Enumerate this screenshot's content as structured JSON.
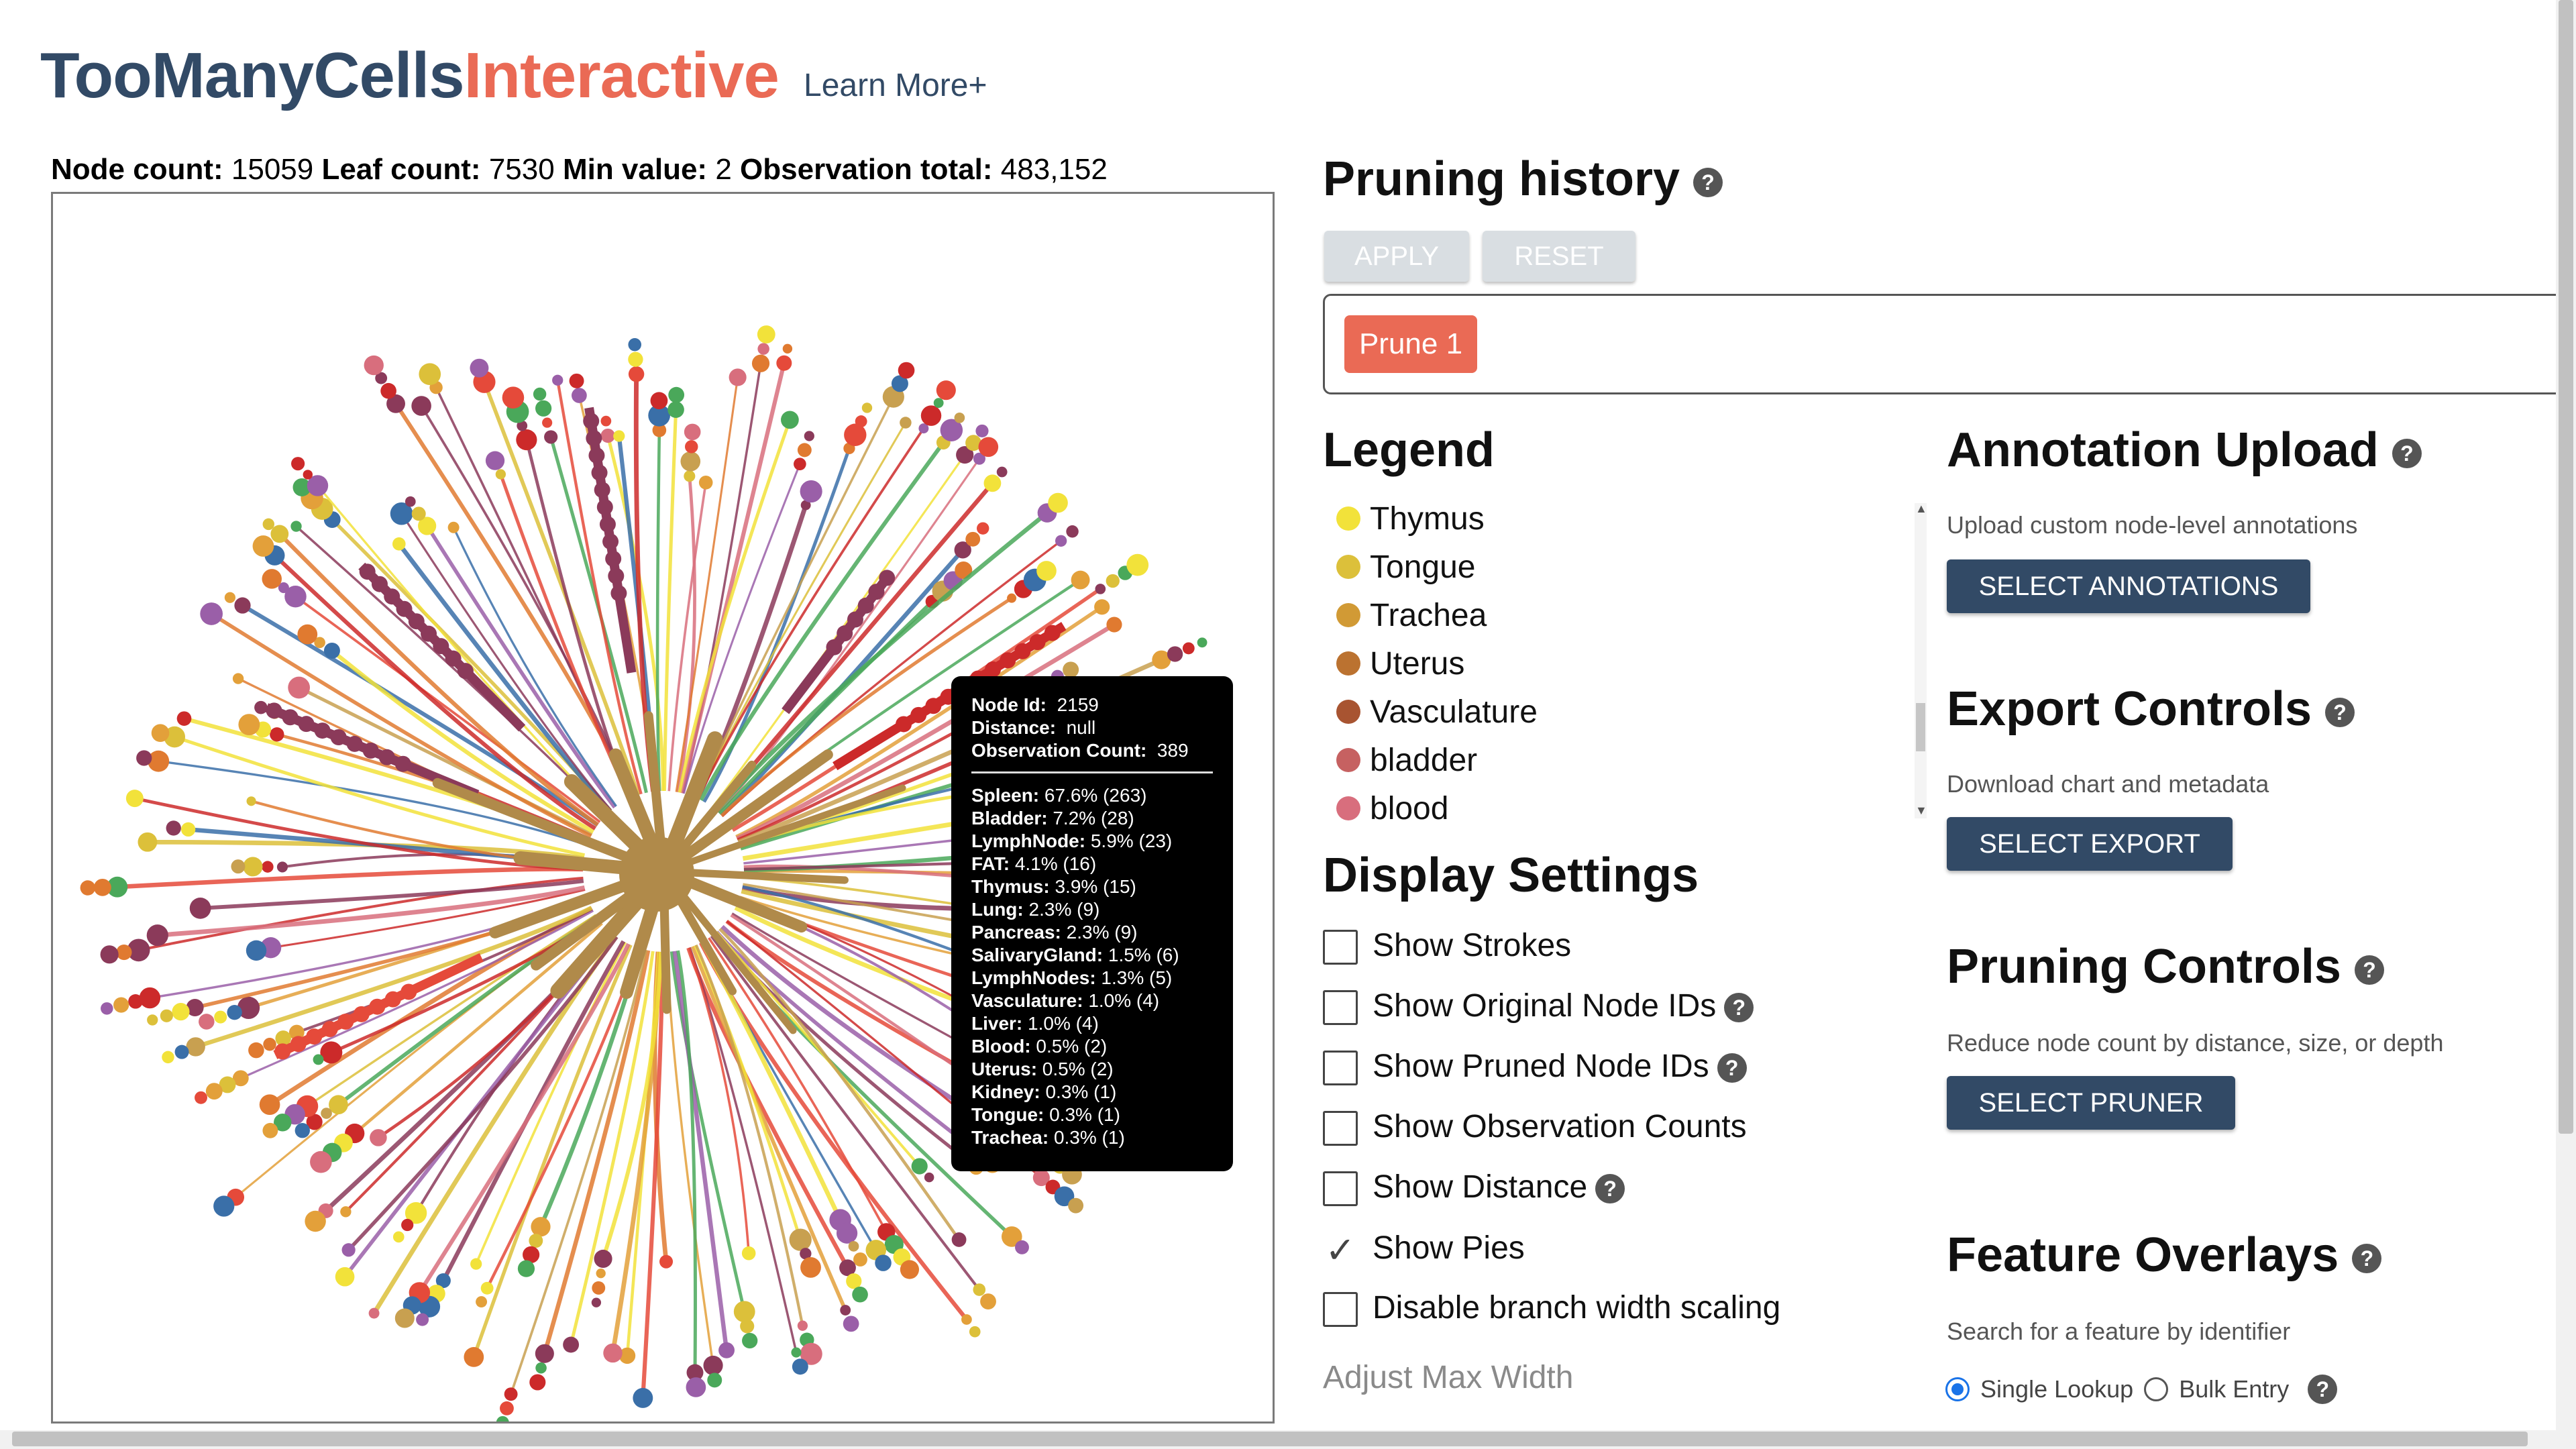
{
  "header": {
    "title_part1": "TooManyCells",
    "title_part2": "Interactive",
    "learn_more": "Learn More+"
  },
  "stats": {
    "node_count_label": "Node count:",
    "node_count": "15059",
    "leaf_count_label": "Leaf count:",
    "leaf_count": "7530",
    "min_value_label": "Min value:",
    "min_value": "2",
    "observation_total_label": "Observation total:",
    "observation_total": "483,152"
  },
  "tooltip": {
    "node_id_label": "Node Id:",
    "node_id": "2159",
    "distance_label": "Distance:",
    "distance": "null",
    "observation_count_label": "Observation Count:",
    "observation_count": "389",
    "composition": [
      {
        "label": "Spleen:",
        "value": "67.6% (263)"
      },
      {
        "label": "Bladder:",
        "value": "7.2% (28)"
      },
      {
        "label": "LymphNode:",
        "value": "5.9% (23)"
      },
      {
        "label": "FAT:",
        "value": "4.1% (16)"
      },
      {
        "label": "Thymus:",
        "value": "3.9% (15)"
      },
      {
        "label": "Lung:",
        "value": "2.3% (9)"
      },
      {
        "label": "Pancreas:",
        "value": "2.3% (9)"
      },
      {
        "label": "SalivaryGland:",
        "value": "1.5% (6)"
      },
      {
        "label": "LymphNodes:",
        "value": "1.3% (5)"
      },
      {
        "label": "Vasculature:",
        "value": "1.0% (4)"
      },
      {
        "label": "Liver:",
        "value": "1.0% (4)"
      },
      {
        "label": "Blood:",
        "value": "0.5% (2)"
      },
      {
        "label": "Uterus:",
        "value": "0.5% (2)"
      },
      {
        "label": "Kidney:",
        "value": "0.3% (1)"
      },
      {
        "label": "Tongue:",
        "value": "0.3% (1)"
      },
      {
        "label": "Trachea:",
        "value": "0.3% (1)"
      }
    ]
  },
  "pruning_history": {
    "title": "Pruning history",
    "apply_label": "APPLY",
    "reset_label": "RESET",
    "chip_label": "Prune 1"
  },
  "legend": {
    "title": "Legend",
    "items": [
      {
        "label": "Thymus",
        "color": "#f2e23a"
      },
      {
        "label": "Tongue",
        "color": "#dcc03a"
      },
      {
        "label": "Trachea",
        "color": "#d19a35"
      },
      {
        "label": "Uterus",
        "color": "#bb7230"
      },
      {
        "label": "Vasculature",
        "color": "#a85431"
      },
      {
        "label": "bladder",
        "color": "#c66161"
      },
      {
        "label": "blood",
        "color": "#d86e7d"
      }
    ]
  },
  "display_settings": {
    "title": "Display Settings",
    "options": [
      {
        "label": "Show Strokes",
        "checked": false,
        "help": false
      },
      {
        "label": "Show Original Node IDs",
        "checked": false,
        "help": true
      },
      {
        "label": "Show Pruned Node IDs",
        "checked": false,
        "help": true
      },
      {
        "label": "Show Observation Counts",
        "checked": false,
        "help": false
      },
      {
        "label": "Show Distance",
        "checked": false,
        "help": true
      },
      {
        "label": "Show Pies",
        "checked": true,
        "help": false
      },
      {
        "label": "Disable branch width scaling",
        "checked": false,
        "help": false
      }
    ],
    "adjust_max_width": "Adjust Max Width"
  },
  "annotation_upload": {
    "title": "Annotation Upload",
    "description": "Upload custom node-level annotations",
    "button": "SELECT ANNOTATIONS"
  },
  "export_controls": {
    "title": "Export Controls",
    "description": "Download chart and metadata",
    "button": "SELECT EXPORT"
  },
  "pruning_controls": {
    "title": "Pruning Controls",
    "description": "Reduce node count by distance, size, or depth",
    "button": "SELECT PRUNER"
  },
  "feature_overlays": {
    "title": "Feature Overlays",
    "description": "Search for a feature by identifier",
    "single_lookup": "Single Lookup",
    "bulk_entry": "Bulk Entry"
  },
  "help_glyph": "?",
  "tree_colors": [
    "#8b3a5a",
    "#f2e23a",
    "#e3a03a",
    "#4aa85a",
    "#e54a3a",
    "#9a5fa8",
    "#3a6fa8",
    "#d86e7d",
    "#dcc03a",
    "#cc2a2a",
    "#c8a050",
    "#e07a30"
  ]
}
